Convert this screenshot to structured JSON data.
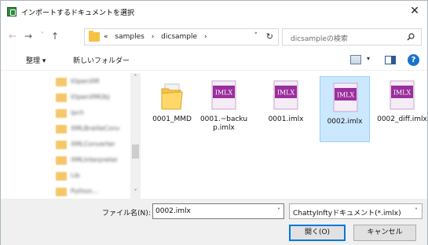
{
  "window": {
    "title": "インポートするドキュメントを選択",
    "close_glyph": "✕"
  },
  "nav": {
    "back_glyph": "←",
    "forward_glyph": "→",
    "recent_glyph": "˅",
    "up_glyph": "↑"
  },
  "address": {
    "crumbs": [
      "«",
      "samples",
      "›",
      "dicsample",
      "›"
    ],
    "dropdown_glyph": "˅",
    "refresh_glyph": "↻"
  },
  "search": {
    "placeholder": "dicsampleの検索"
  },
  "toolbar": {
    "organize_label": "整理 ▾",
    "new_folder_label": "新しいフォルダー",
    "view_drop_glyph": "▾",
    "help_glyph": "?"
  },
  "navpane": {
    "scroll_up_glyph": "˄",
    "scroll_down_glyph": "˅",
    "items": [
      {
        "label": "IOpenXM"
      },
      {
        "label": "IOpenXMObj"
      },
      {
        "label": "ipch"
      },
      {
        "label": "XMLBrailleConv"
      },
      {
        "label": "XMLConverter"
      },
      {
        "label": "XMLInterpreter"
      },
      {
        "label": "Lib"
      },
      {
        "label": "Python..."
      }
    ]
  },
  "files": [
    {
      "name": "0001_MMD",
      "kind": "folder",
      "selected": false
    },
    {
      "name": "0001.~backup.imlx",
      "kind": "imlx",
      "selected": false
    },
    {
      "name": "0001.imlx",
      "kind": "imlx",
      "selected": false
    },
    {
      "name": "0002.imlx",
      "kind": "imlx",
      "selected": true
    },
    {
      "name": "0002_diff.imlx",
      "kind": "imlx",
      "selected": false
    }
  ],
  "icon_label": "IMLX",
  "bottom": {
    "filename_label": "ファイル名(N):",
    "filename_value": "0002.imlx",
    "filetype_value": "ChattyInftyドキュメント(*.imlx)",
    "dropdown_glyph": "˅",
    "open_label": "開く(O)",
    "cancel_label": "キャンセル"
  },
  "colors": {
    "selection_bg": "#cce8ff",
    "selection_border": "#99d1ff",
    "accent": "#0078d7",
    "imlx_purple": "#9b2f9d"
  }
}
